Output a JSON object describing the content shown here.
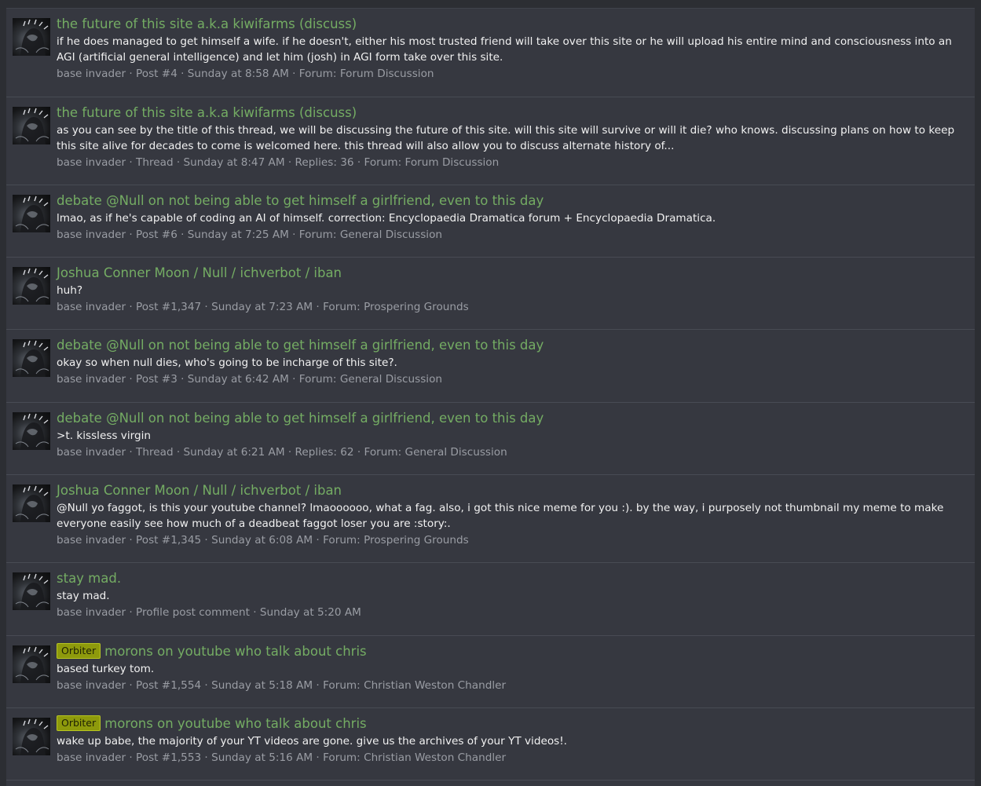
{
  "results": [
    {
      "badge": "",
      "title": "the future of this site a.k.a kiwifarms (discuss)",
      "snippet": "if he does managed to get himself a wife. if he doesn't, either his most trusted friend will take over this site or he will upload his entire mind and consciousness into an AGI (artificial general intelligence) and let him (josh) in AGI form take over this site.",
      "user": "base invader",
      "meta": " · Post #4 · Sunday at 8:58 AM · Forum: ",
      "forum": "Forum Discussion"
    },
    {
      "badge": "",
      "title": "the future of this site a.k.a kiwifarms (discuss)",
      "snippet": "as you can see by the title of this thread, we will be discussing the future of this site. will this site will survive or will it die? who knows. discussing plans on how to keep this site alive for decades to come is welcomed here. this thread will also allow you to discuss alternate history of...",
      "user": "base invader",
      "meta": " · Thread · Sunday at 8:47 AM · Replies: 36 · Forum: ",
      "forum": "Forum Discussion"
    },
    {
      "badge": "",
      "title": "debate @Null on not being able to get himself a girlfriend, even to this day",
      "snippet": "lmao, as if he's capable of coding an AI of himself. correction: Encyclopaedia Dramatica forum + Encyclopaedia Dramatica.",
      "user": "base invader",
      "meta": " · Post #6 · Sunday at 7:25 AM · Forum: ",
      "forum": "General Discussion"
    },
    {
      "badge": "",
      "title": "Joshua Conner Moon / Null / ichverbot / iban",
      "snippet": "huh?",
      "user": "base invader",
      "meta": " · Post #1,347 · Sunday at 7:23 AM · Forum: ",
      "forum": "Prospering Grounds"
    },
    {
      "badge": "",
      "title": "debate @Null on not being able to get himself a girlfriend, even to this day",
      "snippet": "okay so when null dies, who's going to be incharge of this site?.",
      "user": "base invader",
      "meta": " · Post #3 · Sunday at 6:42 AM · Forum: ",
      "forum": "General Discussion"
    },
    {
      "badge": "",
      "title": "debate @Null on not being able to get himself a girlfriend, even to this day",
      "snippet": ">t. kissless virgin",
      "user": "base invader",
      "meta": " · Thread · Sunday at 6:21 AM · Replies: 62 · Forum: ",
      "forum": "General Discussion"
    },
    {
      "badge": "",
      "title": "Joshua Conner Moon / Null / ichverbot / iban",
      "snippet": "@Null yo faggot, is this your youtube channel? lmaoooooo, what a fag. also, i got this nice meme for you :). by the way, i purposely not thumbnail my meme to make everyone easily see how much of a deadbeat faggot loser you are :story:.",
      "user": "base invader",
      "meta": " · Post #1,345 · Sunday at 6:08 AM · Forum: ",
      "forum": "Prospering Grounds"
    },
    {
      "badge": "",
      "title": "stay mad.",
      "snippet": "stay mad.",
      "user": "base invader",
      "meta": " · Profile post comment · Sunday at 5:20 AM",
      "forum": ""
    },
    {
      "badge": "Orbiter",
      "title": "morons on youtube who talk about chris",
      "snippet": "based turkey tom.",
      "user": "base invader",
      "meta": " · Post #1,554 · Sunday at 5:18 AM · Forum: ",
      "forum": "Christian Weston Chandler"
    },
    {
      "badge": "Orbiter",
      "title": "morons on youtube who talk about chris",
      "snippet": "wake up babe, the majority of your YT videos are gone. give us the archives of your YT videos!.",
      "user": "base invader",
      "meta": " · Post #1,553 · Sunday at 5:16 AM · Forum: ",
      "forum": "Christian Weston Chandler"
    }
  ]
}
